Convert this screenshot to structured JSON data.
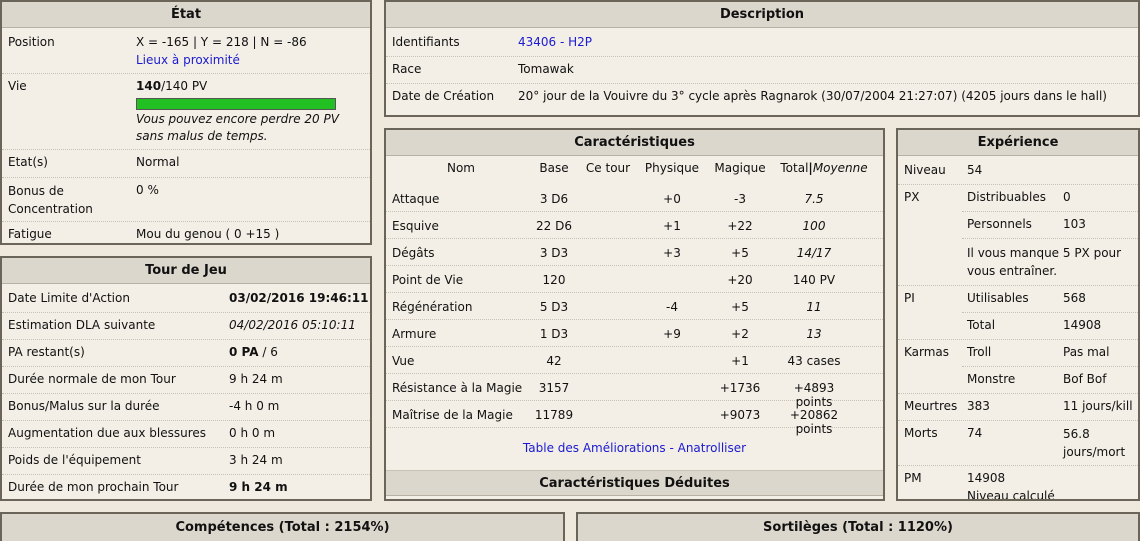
{
  "etat": {
    "title": "État",
    "position_label": "Position",
    "position_value": "X = -165 | Y = 218 | N = -86",
    "lieux_link": "Lieux à proximité",
    "vie_label": "Vie",
    "vie_current": "140",
    "vie_max": "/140 PV",
    "vie_fraction": 1.0,
    "vie_note": "Vous pouvez encore perdre 20 PV sans malus de temps.",
    "etats_label": "Etat(s)",
    "etats_value": "Normal",
    "bonus_label": "Bonus de Concentration",
    "bonus_value": "0 %",
    "fatigue_label": "Fatigue",
    "fatigue_value": "Mou du genou ( 0 +15 )"
  },
  "description": {
    "title": "Description",
    "id_label": "Identifiants",
    "id_value": "43406 - H2P",
    "race_label": "Race",
    "race_value": "Tomawak",
    "date_label": "Date de Création",
    "date_value": "20° jour de la Vouivre du 3° cycle après Ragnarok (30/07/2004 21:27:07) (4205 jours dans le hall)"
  },
  "tour": {
    "title": "Tour de Jeu",
    "rows": [
      {
        "label": "Date Limite d'Action",
        "value": "03/02/2016 19:46:11"
      },
      {
        "label": "Estimation DLA suivante",
        "value": "04/02/2016 05:10:11"
      },
      {
        "label": "PA restant(s)",
        "value_b": "0 PA",
        "value_rest": " / 6"
      },
      {
        "label": "Durée normale de mon Tour",
        "value": "9 h 24 m"
      },
      {
        "label": "Bonus/Malus sur la durée",
        "value": "-4 h 0 m"
      },
      {
        "label": "Augmentation due aux blessures",
        "value": "0 h 0 m"
      },
      {
        "label": "Poids de l'équipement",
        "value": "3 h 24 m"
      },
      {
        "label": "Durée de mon prochain Tour",
        "value": "9 h 24 m"
      }
    ]
  },
  "carac": {
    "title": "Caractéristiques",
    "headers": {
      "nom": "Nom",
      "base": "Base",
      "cetour": "Ce tour",
      "physique": "Physique",
      "magique": "Magique",
      "total": "Total",
      "sep": "|",
      "moyenne": "Moyenne"
    },
    "rows": [
      {
        "nom": "Attaque",
        "base": "3 D6",
        "cetour": "",
        "physique": "+0",
        "magique": "-3",
        "total": "7.5"
      },
      {
        "nom": "Esquive",
        "base": "22 D6",
        "cetour": "",
        "physique": "+1",
        "magique": "+22",
        "total": "100"
      },
      {
        "nom": "Dégâts",
        "base": "3 D3",
        "cetour": "",
        "physique": "+3",
        "magique": "+5",
        "total": "14/17"
      },
      {
        "nom": "Point de Vie",
        "base": "120",
        "cetour": "",
        "physique": "",
        "magique": "+20",
        "total": "140 PV"
      },
      {
        "nom": "Régénération",
        "base": "5 D3",
        "cetour": "",
        "physique": "-4",
        "magique": "+5",
        "total": "11"
      },
      {
        "nom": "Armure",
        "base": "1 D3",
        "cetour": "",
        "physique": "+9",
        "magique": "+2",
        "total": "13"
      },
      {
        "nom": "Vue",
        "base": "42",
        "cetour": "",
        "physique": "",
        "magique": "+1",
        "total": "43 cases"
      },
      {
        "nom": "Résistance à la Magie",
        "base": "3157",
        "cetour": "",
        "physique": "",
        "magique": "+1736",
        "total": "+4893 points"
      },
      {
        "nom": "Maîtrise de la Magie",
        "base": "11789",
        "cetour": "",
        "physique": "",
        "magique": "+9073",
        "total": "+20862 points"
      }
    ],
    "links": "Table des Améliorations - Anatrolliser",
    "deduites_title": "Caractéristiques Déduites"
  },
  "exp": {
    "title": "Expérience",
    "niveau_label": "Niveau",
    "niveau_value": "54",
    "px_label": "PX",
    "px_dist_label": "Distribuables",
    "px_dist_value": "0",
    "px_pers_label": "Personnels",
    "px_pers_value": "103",
    "px_note": "Il vous manque 5 PX pour vous entraîner.",
    "pi_label": "PI",
    "pi_util_label": "Utilisables",
    "pi_util_value": "568",
    "pi_total_label": "Total",
    "pi_total_value": "14908",
    "karmas_label": "Karmas",
    "karma_troll_label": "Troll",
    "karma_troll_value": "Pas mal",
    "karma_monstre_label": "Monstre",
    "karma_monstre_value": "Bof Bof",
    "meurtres_label": "Meurtres",
    "meurtres_value": "383",
    "meurtres_rate": "11 jours/kill",
    "morts_label": "Morts",
    "morts_value": "74",
    "morts_rate": "56.8 jours/mort",
    "pm_label": "PM",
    "pm_value": "14908",
    "pm_note": "Niveau calculé"
  },
  "competences": {
    "title": "Compétences (Total : 2154%)"
  },
  "sortileges": {
    "title": "Sortilèges (Total : 1120%)"
  }
}
